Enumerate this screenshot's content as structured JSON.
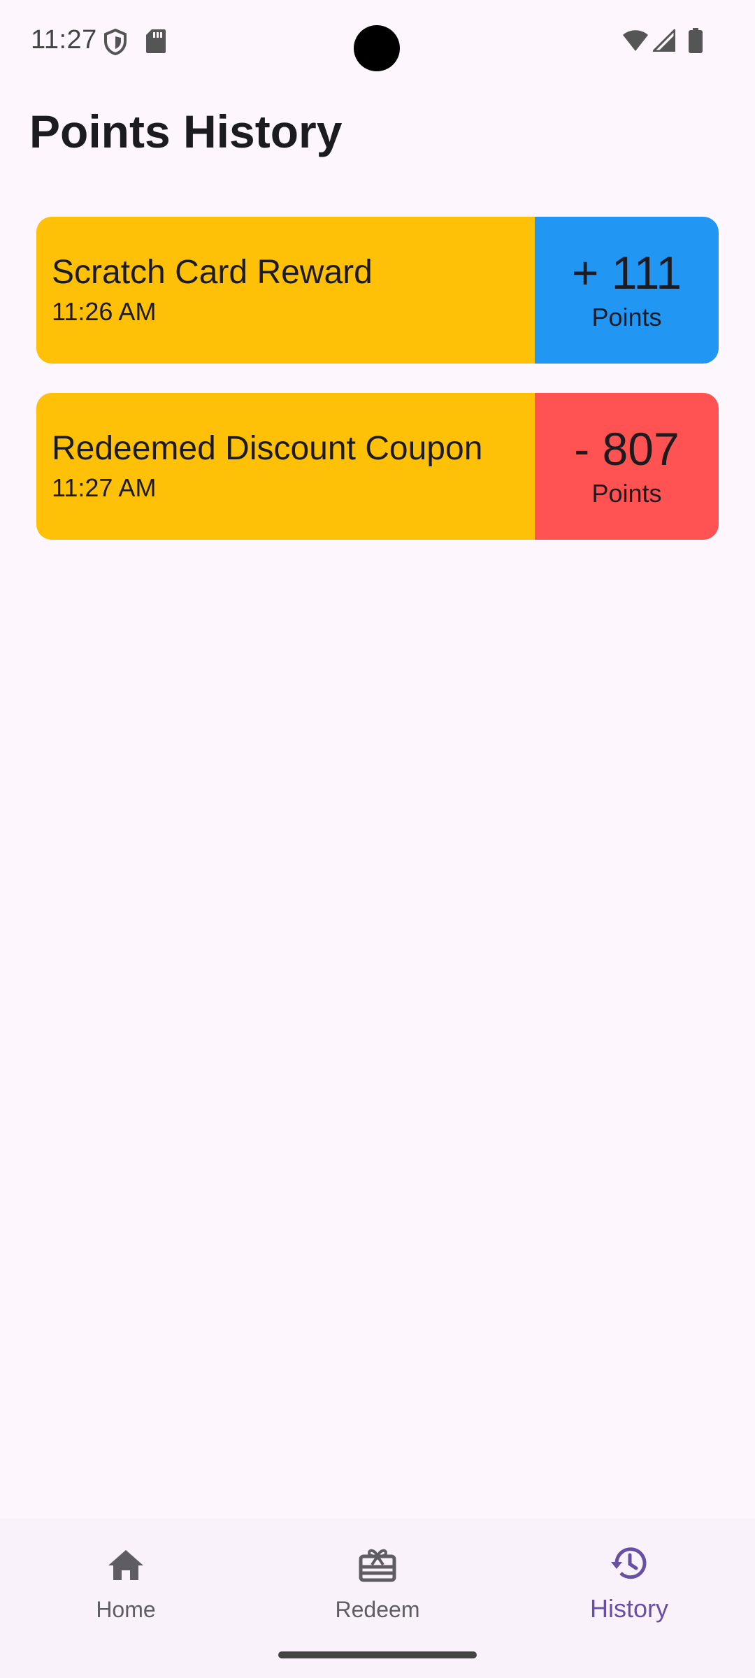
{
  "status_bar": {
    "time": "11:27"
  },
  "header": {
    "title": "Points History"
  },
  "history": [
    {
      "title": "Scratch Card Reward",
      "time": "11:26 AM",
      "amount": "+ 111",
      "unit": "Points",
      "type": "credit"
    },
    {
      "title": "Redeemed Discount Coupon",
      "time": "11:27 AM",
      "amount": "- 807",
      "unit": "Points",
      "type": "debit"
    }
  ],
  "colors": {
    "card_left": "#ffc107",
    "credit": "#2196f3",
    "debit": "#ff5252",
    "nav_active": "#6750a4",
    "nav_inactive": "#5f5c64",
    "background": "#fdf7fd"
  },
  "bottom_nav": {
    "items": [
      {
        "label": "Home",
        "icon": "home-icon",
        "active": false
      },
      {
        "label": "Redeem",
        "icon": "gift-card-icon",
        "active": false
      },
      {
        "label": "History",
        "icon": "history-icon",
        "active": true
      }
    ]
  }
}
